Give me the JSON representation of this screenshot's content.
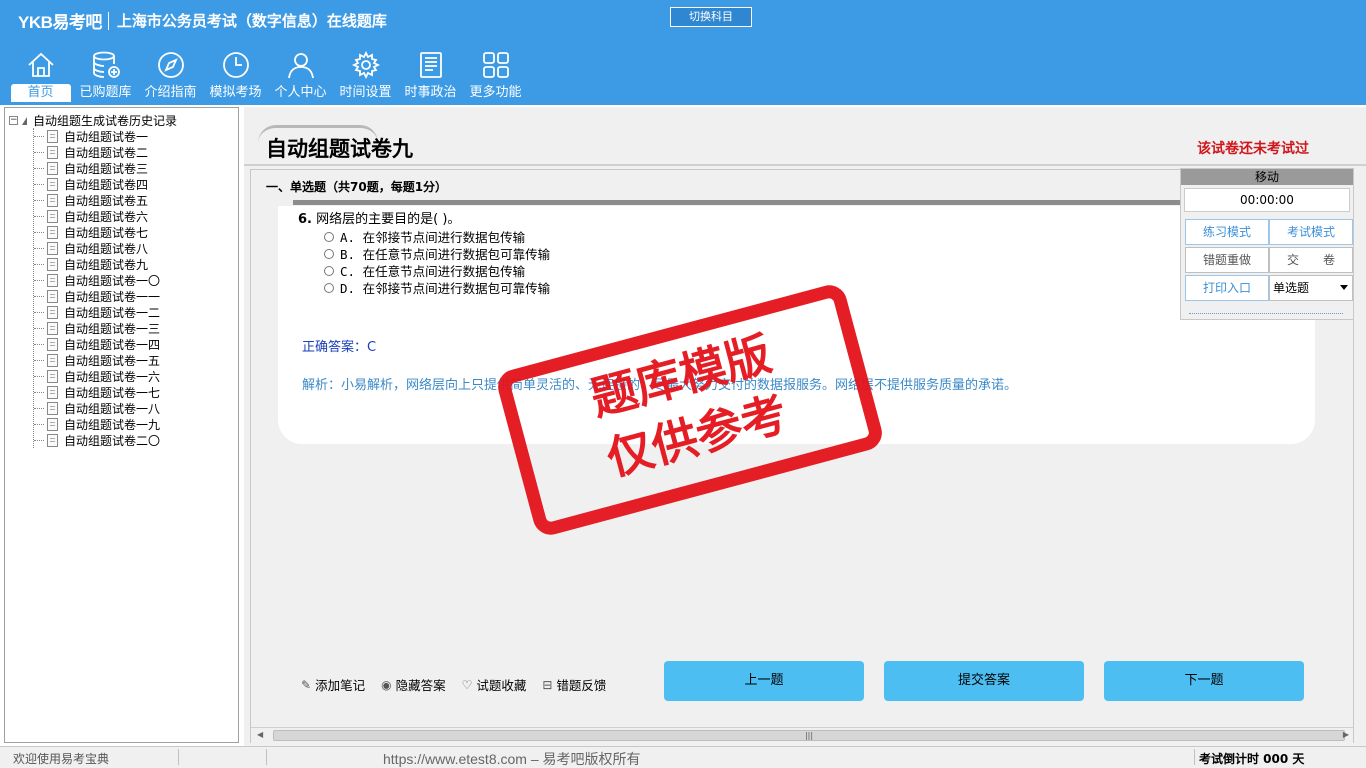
{
  "header": {
    "logo": "YKB易考吧",
    "app_title": "上海市公务员考试（数字信息）在线题库",
    "switch_subject": "切换科目"
  },
  "nav": [
    {
      "label": "首页",
      "icon": "home-icon"
    },
    {
      "label": "已购题库",
      "icon": "database-icon"
    },
    {
      "label": "介绍指南",
      "icon": "compass-icon"
    },
    {
      "label": "模拟考场",
      "icon": "clock-icon"
    },
    {
      "label": "个人中心",
      "icon": "user-icon"
    },
    {
      "label": "时间设置",
      "icon": "gear-icon"
    },
    {
      "label": "时事政治",
      "icon": "news-icon"
    },
    {
      "label": "更多功能",
      "icon": "grid-icon"
    }
  ],
  "tree": {
    "root": "自动组题生成试卷历史记录",
    "items": [
      "自动组题试卷一",
      "自动组题试卷二",
      "自动组题试卷三",
      "自动组题试卷四",
      "自动组题试卷五",
      "自动组题试卷六",
      "自动组题试卷七",
      "自动组题试卷八",
      "自动组题试卷九",
      "自动组题试卷一〇",
      "自动组题试卷一一",
      "自动组题试卷一二",
      "自动组题试卷一三",
      "自动组题试卷一四",
      "自动组题试卷一五",
      "自动组题试卷一六",
      "自动组题试卷一七",
      "自动组题试卷一八",
      "自动组题试卷一九",
      "自动组题试卷二〇"
    ]
  },
  "paper": {
    "title": "自动组题试卷九",
    "status": "该试卷还未考试过",
    "section": "一、单选题（共70题，每题1分）"
  },
  "question": {
    "number": "6.",
    "stem": "网络层的主要目的是( )。",
    "options": [
      "A. 在邻接节点间进行数据包传输",
      "B. 在任意节点间进行数据包可靠传输",
      "C. 在任意节点间进行数据包传输",
      "D. 在邻接节点间进行数据包可靠传输"
    ],
    "answer": "正确答案：C",
    "explanation": "解析：小易解析，网络层向上只提供简单灵活的、无连接的、尽最大努力交付的数据报服务。网络层不提供服务质量的承诺。"
  },
  "tools": [
    {
      "label": "添加笔记",
      "icon": "pencil-icon"
    },
    {
      "label": "隐藏答案",
      "icon": "eye-icon"
    },
    {
      "label": "试题收藏",
      "icon": "heart-icon"
    },
    {
      "label": "错题反馈",
      "icon": "feedback-icon"
    }
  ],
  "buttons": {
    "prev": "上一题",
    "submit": "提交答案",
    "next": "下一题"
  },
  "panel": {
    "header": "移动",
    "timer": "00:00:00",
    "practice_mode": "练习模式",
    "exam_mode": "考试模式",
    "redo_wrong": "错题重做",
    "hand_in": "交　　卷",
    "print": "打印入口",
    "type_select": "单选题"
  },
  "stamp": {
    "line1": "题库模版",
    "line2": "仅供参考"
  },
  "statusbar": {
    "welcome": "欢迎使用易考宝典",
    "copyright": "https://www.etest8.com – 易考吧版权所有",
    "countdown": "考试倒计时 000 天"
  },
  "colors": {
    "header_bg": "#3d9be6",
    "button_bg": "#4cbef2",
    "status_red": "#d0161b",
    "answer_blue": "#1a3fb8",
    "explain_blue": "#3b8ac8",
    "stamp_red": "#e4131b"
  }
}
